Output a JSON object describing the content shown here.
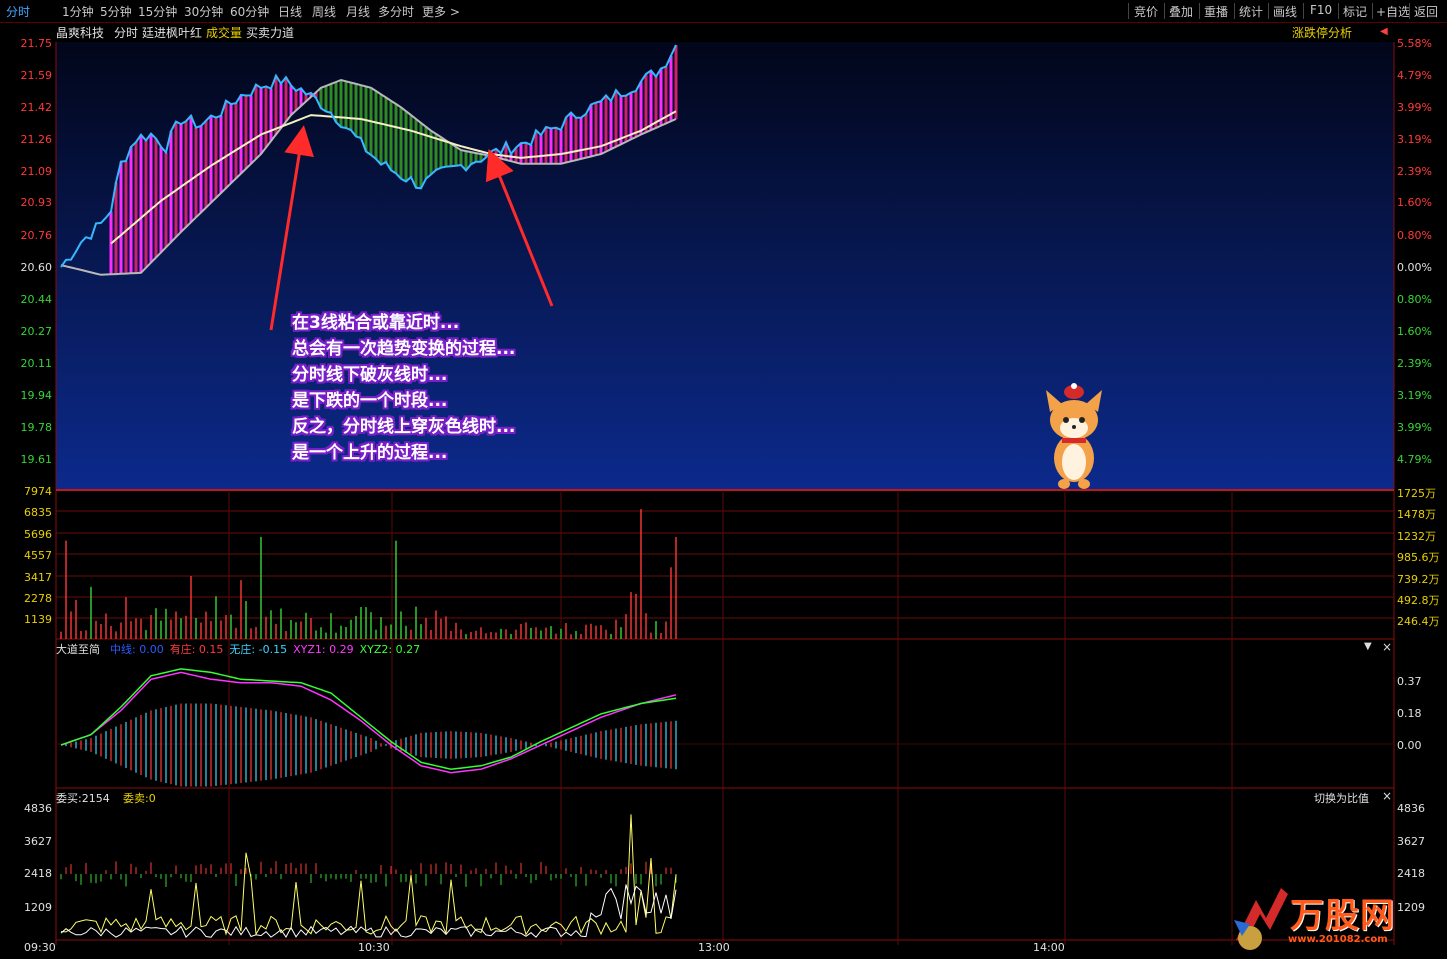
{
  "toolbar": {
    "timeframes": [
      "分时",
      "1分钟",
      "5分钟",
      "15分钟",
      "30分钟",
      "60分钟",
      "日线",
      "周线",
      "月线",
      "多分时",
      "更多 >"
    ],
    "active_index": 0,
    "right_buttons": [
      "竞价",
      "叠加",
      "重播",
      "统计",
      "画线",
      "F10",
      "标记",
      "+自选",
      "返回"
    ]
  },
  "header": {
    "stock_name": "晶爽科技",
    "chart_mode": "分时",
    "indicator_set": "廷进枫叶红",
    "volume_label": "成交量",
    "power_label": "买卖力道",
    "limit_analysis": "涨跌停分析"
  },
  "price_axis": {
    "left": [
      "21.75",
      "21.59",
      "21.42",
      "21.26",
      "21.09",
      "20.93",
      "20.76",
      "20.60",
      "20.44",
      "20.27",
      "20.11",
      "19.94",
      "19.78",
      "19.61"
    ],
    "right": [
      "5.58%",
      "4.79%",
      "3.99%",
      "3.19%",
      "2.39%",
      "1.60%",
      "0.80%",
      "0.00%",
      "0.80%",
      "1.60%",
      "2.39%",
      "3.19%",
      "3.99%",
      "4.79%"
    ]
  },
  "volume_axis": {
    "left": [
      "7974",
      "6835",
      "5696",
      "4557",
      "3417",
      "2278",
      "1139"
    ],
    "right": [
      "1725万",
      "1478万",
      "1232万",
      "985.6万",
      "739.2万",
      "492.8万",
      "246.4万"
    ]
  },
  "indicator": {
    "name": "大道至简",
    "items": [
      {
        "label": "中线",
        "value": "0.00",
        "color": "#2a5bff"
      },
      {
        "label": "有庄",
        "value": "0.15",
        "color": "#ff3a3a"
      },
      {
        "label": "无庄",
        "value": "-0.15",
        "color": "#3ad6ff"
      },
      {
        "label": "XYZ1",
        "value": "0.29",
        "color": "#ff3aff"
      },
      {
        "label": "XYZ2",
        "value": "0.27",
        "color": "#3aff3a"
      }
    ],
    "axis": [
      "0.37",
      "0.18",
      "0.00"
    ]
  },
  "order_panel": {
    "buy_label": "委买:2154",
    "sell_label": "委卖:0",
    "switch_label": "切换为比值",
    "axis": [
      "4836",
      "3627",
      "2418",
      "1209"
    ]
  },
  "time_axis": [
    "09:30",
    "10:30",
    "13:00",
    "14:00"
  ],
  "annotation": [
    "在3线粘合或靠近时...",
    "总会有一次趋势变换的过程...",
    "分时线下破灰线时...",
    "是下跌的一个时段...",
    "反之，分时线上穿灰色线时...",
    "是一个上升的过程..."
  ],
  "watermark": {
    "brand": "万股网",
    "url": "www.201082.com"
  },
  "colors": {
    "up": "#ff3a3a",
    "down": "#36d636",
    "price_line": "#36b8ff",
    "avg_line": "#f5f0c0",
    "magenta": "#ff33ff",
    "green_band": "#2a8a1a"
  }
}
